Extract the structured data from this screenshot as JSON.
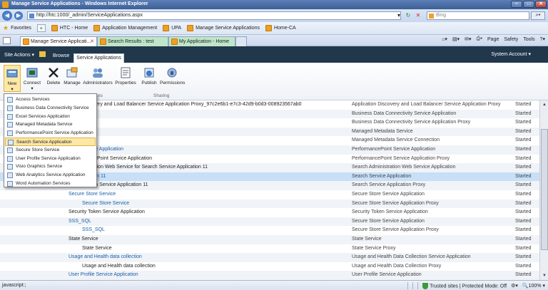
{
  "window": {
    "title": "Manage Service Applications - Windows Internet Explorer"
  },
  "address_bar": {
    "url": "http://htc:1000/_admin/ServiceApplications.aspx",
    "search_placeholder": "Bing"
  },
  "favorites_bar": {
    "favorites_label": "Favorites",
    "items": [
      "HTC - Home",
      "Application Management",
      "UPA",
      "Manage Service Applications",
      "Home-CA"
    ]
  },
  "tabs": [
    {
      "label": "Manage Service Applicati...",
      "active": true
    },
    {
      "label": "Search Results : test",
      "active": false
    },
    {
      "label": "My Application - Home",
      "active": false
    }
  ],
  "command_bar": {
    "page": "Page",
    "safety": "Safety",
    "tools": "Tools"
  },
  "sharepoint": {
    "site_actions": "Site Actions",
    "browse_tab": "Browse",
    "service_apps_tab": "Service Applications",
    "system_account": "System Account"
  },
  "ribbon": {
    "buttons": [
      "New",
      "Connect",
      "Delete",
      "Manage",
      "Administrators",
      "Properties",
      "Publish",
      "Permissions"
    ],
    "groups": [
      "ns",
      "Sharing"
    ]
  },
  "new_menu": {
    "items": [
      "Access Services",
      "Business Data Connectivity Service",
      "Excel Services Application",
      "Managed Metadata Service",
      "PerformancePoint Service Application",
      "Search Service Application",
      "Secure Store Service",
      "User Profile Service Application",
      "Visio Graphics Service",
      "Web Analytics Service Application",
      "Word Automation Services"
    ],
    "highlighted_index": 5
  },
  "table": {
    "rows": [
      {
        "name": "ation Discovery and Load Balancer Service Application Proxy_97c2e6b1-e7c3-42d9-b0d3-008923567ab0",
        "type": "Application Discovery and Load Balancer Service Application Proxy",
        "status": "Started"
      },
      {
        "name": "",
        "type": "Business Data Connectivity Service Application",
        "status": "Started"
      },
      {
        "name": "SQL",
        "type": "Business Data Connectivity Service Application Proxy",
        "status": "Started"
      },
      {
        "name": "",
        "type": "Managed Metadata Service",
        "status": "Started"
      },
      {
        "name": "Sql",
        "type": "Managed Metadata Service Connection",
        "status": "Started"
      },
      {
        "name": "Point Service Application",
        "type": "PerformancePoint Service Application",
        "status": "Started"
      },
      {
        "name": "mancePoint Service Application",
        "type": "PerformancePoint Service Application Proxy",
        "status": "Started"
      },
      {
        "name": "inistration Web Service for Search Service Application 11",
        "type": "Search Administration Web Service Application",
        "status": "Started"
      },
      {
        "name": "ce Application 11",
        "type": "Search Service Application",
        "status": "Started"
      },
      {
        "name": "Search Service Application 11",
        "type": "Search Service Application Proxy",
        "status": "Started"
      },
      {
        "name": "Secure Store Service",
        "type": "Secure Store Service Application",
        "status": "Started"
      },
      {
        "name": "Secure Store Service",
        "type": "Secure Store Service Application Proxy",
        "status": "Started"
      },
      {
        "name": "Security Token Service Application",
        "type": "Security Token Service Application",
        "status": "Started"
      },
      {
        "name": "SSS_SQL",
        "type": "Secure Store Service Application",
        "status": "Started"
      },
      {
        "name": "SSS_SQL",
        "type": "Secure Store Service Application Proxy",
        "status": "Started"
      },
      {
        "name": "State Service",
        "type": "State Service",
        "status": "Started"
      },
      {
        "name": "State Service",
        "type": "State Service Proxy",
        "status": "Started"
      },
      {
        "name": "Usage and Health data collection",
        "type": "Usage and Health Data Collection Service Application",
        "status": "Started"
      },
      {
        "name": "Usage and Health data collection",
        "type": "Usage and Health Data Collection Proxy",
        "status": "Started"
      },
      {
        "name": "User Profile Service Application",
        "type": "User Profile Service Application",
        "status": "Started"
      }
    ]
  },
  "status_bar": {
    "left": "javascript:;",
    "zone": "Trusted sites | Protected Mode: Off",
    "zoom": "100%"
  }
}
